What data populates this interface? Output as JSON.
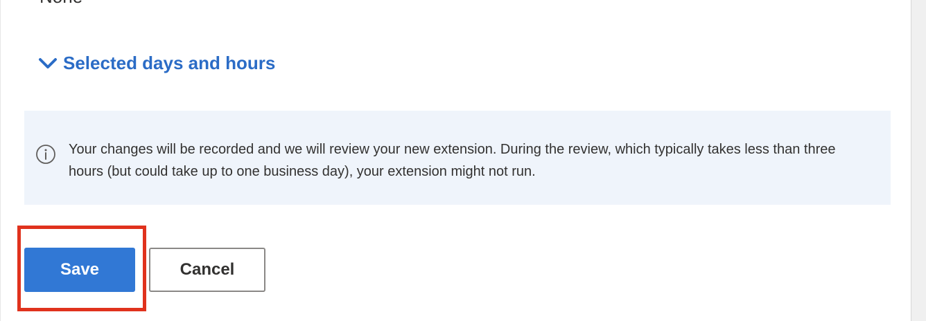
{
  "field": {
    "value": "None"
  },
  "section": {
    "toggle_label": "Selected days and hours",
    "icon": "chevron-down-icon"
  },
  "info": {
    "icon": "info-icon",
    "message": "Your changes will be recorded and we will review your new extension. During the review, which typically takes less than three hours (but could take up to one business day), your extension might not run."
  },
  "actions": {
    "save_label": "Save",
    "cancel_label": "Cancel"
  },
  "colors": {
    "accent": "#3178d5",
    "link": "#2b6cc6",
    "info_background": "#eff4fb",
    "highlight": "#e0321d"
  }
}
